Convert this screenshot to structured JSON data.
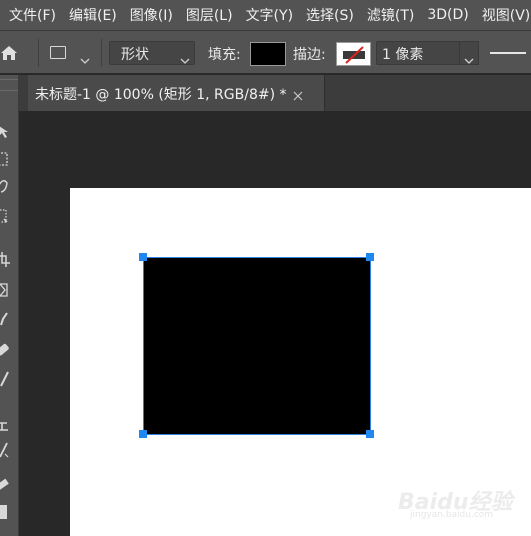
{
  "menu": [
    {
      "label": "文件(F)"
    },
    {
      "label": "编辑(E)"
    },
    {
      "label": "图像(I)"
    },
    {
      "label": "图层(L)"
    },
    {
      "label": "文字(Y)"
    },
    {
      "label": "选择(S)"
    },
    {
      "label": "滤镜(T)"
    },
    {
      "label": "3D(D)"
    },
    {
      "label": "视图(V)"
    }
  ],
  "options": {
    "home_icon": "home-icon",
    "shape_icon": "rectangle-shape-icon",
    "mode_value": "形状",
    "fill_label": "填充:",
    "fill_color": "#000000",
    "stroke_label": "描边:",
    "stroke_state": "none",
    "stroke_width": "1 像素",
    "line_style_icon": "solid-line-icon"
  },
  "document": {
    "tab_title": "未标题-1 @ 100% (矩形 1, RGB/8#) *",
    "close_icon": "close-icon",
    "canvas_color": "#ffffff",
    "shape_fill": "#000000",
    "selection_color": "#1f87f0"
  },
  "watermark": {
    "text": "Baidu经验",
    "sub": "jingyan.baidu.com"
  }
}
